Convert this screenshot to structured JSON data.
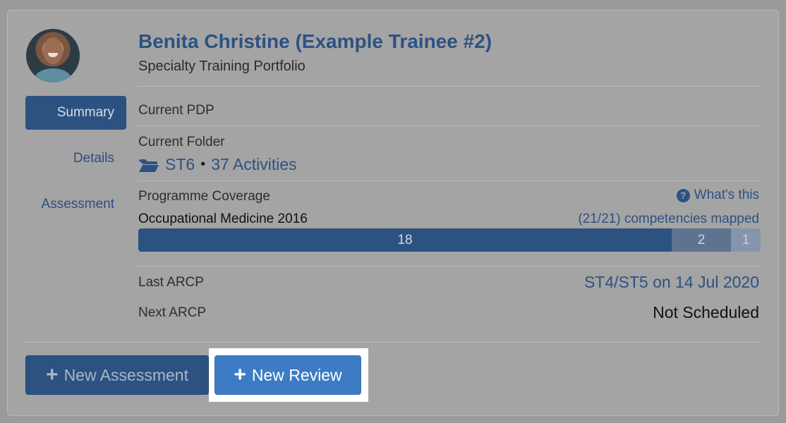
{
  "trainee": {
    "name": "Benita Christine (Example Trainee #2)",
    "portfolio": "Specialty Training Portfolio"
  },
  "nav": {
    "items": [
      {
        "label": "Summary",
        "active": true
      },
      {
        "label": "Details",
        "active": false
      },
      {
        "label": "Assessment",
        "active": false
      }
    ]
  },
  "summary": {
    "current_pdp_label": "Current PDP",
    "current_folder_label": "Current Folder",
    "folder_name": "ST6",
    "separator": "•",
    "activities": "37 Activities",
    "programme_coverage_label": "Programme Coverage",
    "whats_this": "What's this",
    "programme_name": "Occupational Medicine 2016",
    "competencies_mapped": "(21/21) competencies mapped",
    "coverage_segments": [
      {
        "label": "18",
        "value": 18,
        "color": "#2c5282"
      },
      {
        "label": "2",
        "value": 2,
        "color": "#5f7390"
      },
      {
        "label": "1",
        "value": 1,
        "color": "#8595ac"
      }
    ],
    "last_arcp_label": "Last ARCP",
    "last_arcp_value": "ST4/ST5 on 14 Jul 2020",
    "next_arcp_label": "Next ARCP",
    "next_arcp_value": "Not Scheduled"
  },
  "actions": {
    "new_assessment": "New Assessment",
    "new_review": "New Review"
  },
  "icons": {
    "folder": "folder-open-icon",
    "help": "question-circle-icon",
    "plus": "plus-icon"
  }
}
